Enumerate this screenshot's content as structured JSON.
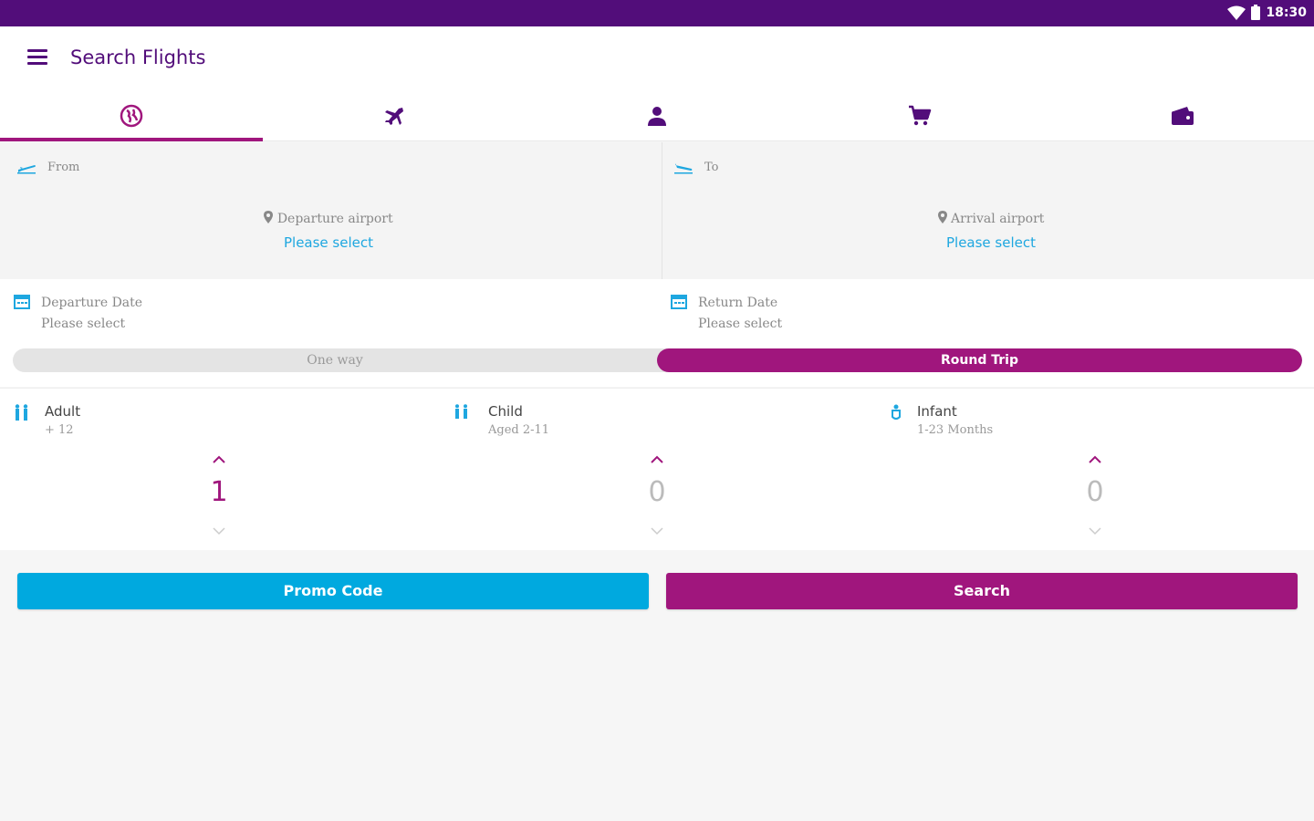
{
  "status_bar": {
    "time": "18:30",
    "icons": [
      "wifi-icon",
      "battery-icon"
    ]
  },
  "app_bar": {
    "title": "Search Flights",
    "menu_icon": "hamburger-menu-icon"
  },
  "tabs": [
    {
      "icon": "globe-icon",
      "active": true
    },
    {
      "icon": "airplane-icon",
      "active": false
    },
    {
      "icon": "person-icon",
      "active": false
    },
    {
      "icon": "cart-icon",
      "active": false
    },
    {
      "icon": "wallet-icon",
      "active": false
    }
  ],
  "route": {
    "from": {
      "label": "From",
      "hint": "Departure airport",
      "value": "Please select"
    },
    "to": {
      "label": "To",
      "hint": "Arrival airport",
      "value": "Please select"
    }
  },
  "dates": {
    "departure": {
      "label": "Departure Date",
      "value": "Please select"
    },
    "return": {
      "label": "Return Date",
      "value": "Please select"
    }
  },
  "trip_type": {
    "one_way": "One way",
    "round_trip": "Round Trip",
    "selected": "Round Trip"
  },
  "passengers": {
    "adult": {
      "label": "Adult",
      "sub": "+ 12",
      "count": "1"
    },
    "child": {
      "label": "Child",
      "sub": "Aged 2-11",
      "count": "0"
    },
    "infant": {
      "label": "Infant",
      "sub": "1-23 Months",
      "count": "0"
    }
  },
  "buttons": {
    "promo": "Promo Code",
    "search": "Search"
  },
  "colors": {
    "primary": "#520d7a",
    "accent": "#a0167d",
    "link": "#1ea7e0",
    "promo": "#00a9df"
  }
}
